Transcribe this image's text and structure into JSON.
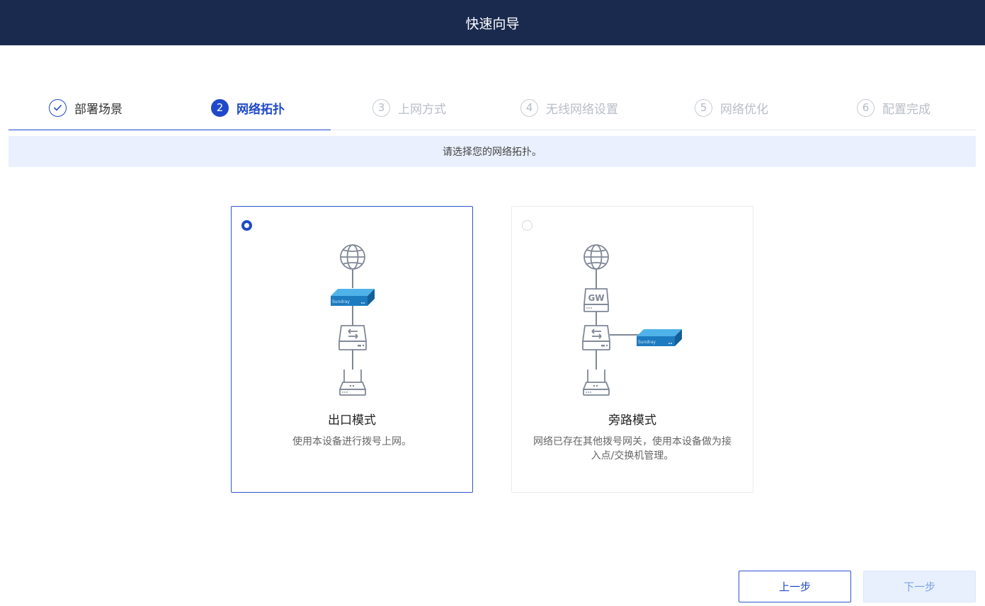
{
  "header": {
    "title": "快速向导"
  },
  "steps": [
    {
      "number": "",
      "label": "部署场景",
      "state": "done"
    },
    {
      "number": "2",
      "label": "网络拓扑",
      "state": "active"
    },
    {
      "number": "3",
      "label": "上网方式",
      "state": "pending"
    },
    {
      "number": "4",
      "label": "无线网络设置",
      "state": "pending"
    },
    {
      "number": "5",
      "label": "网络优化",
      "state": "pending"
    },
    {
      "number": "6",
      "label": "配置完成",
      "state": "pending"
    }
  ],
  "hint": "请选择您的网络拓扑。",
  "options": [
    {
      "title": "出口模式",
      "description": "使用本设备进行拨号上网。",
      "selected": true,
      "device_brand": "Sundray"
    },
    {
      "title": "旁路模式",
      "description": "网络已存在其他拨号网关，使用本设备做为接入点/交换机管理。",
      "selected": false,
      "gateway_label": "GW",
      "device_brand": "Sundray"
    }
  ],
  "footer": {
    "prev_label": "上一步",
    "next_label": "下一步"
  },
  "colors": {
    "topbar": "#1a2a4f",
    "accent": "#1f49c9",
    "hint_bg": "#eaf0fd",
    "device_blue": "#1d7bc0"
  }
}
